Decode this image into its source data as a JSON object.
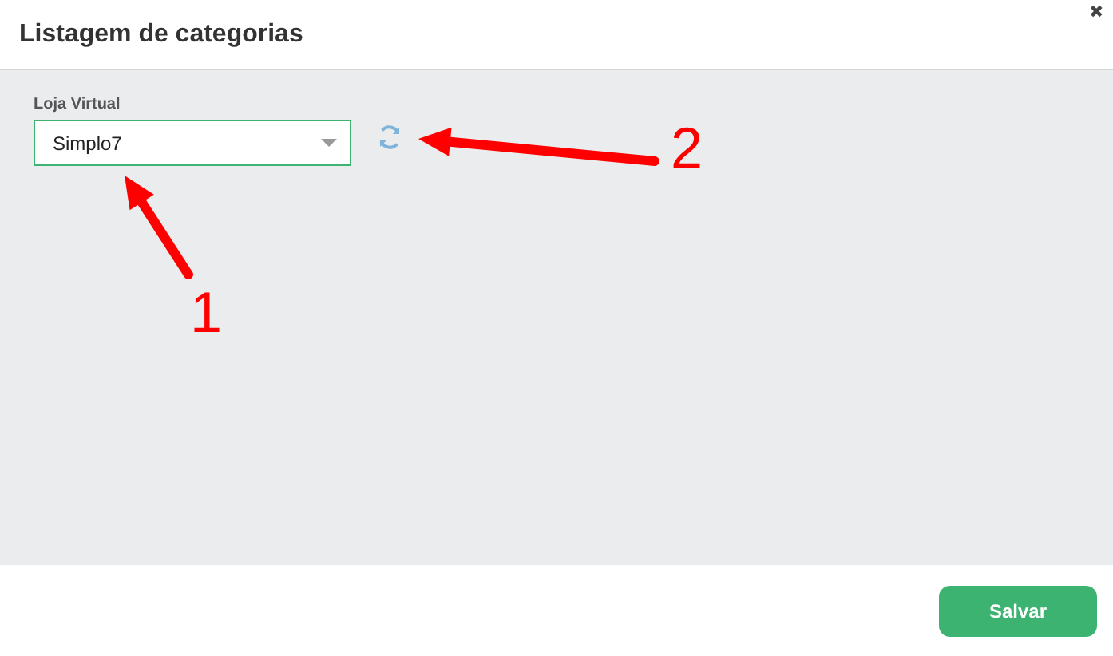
{
  "dialog": {
    "title": "Listagem de categorias",
    "close": "✖"
  },
  "field": {
    "label": "Loja Virtual",
    "value": "Simplo7"
  },
  "annotations": [
    {
      "label": "1"
    },
    {
      "label": "2"
    }
  ],
  "buttons": [
    "Salvar"
  ]
}
